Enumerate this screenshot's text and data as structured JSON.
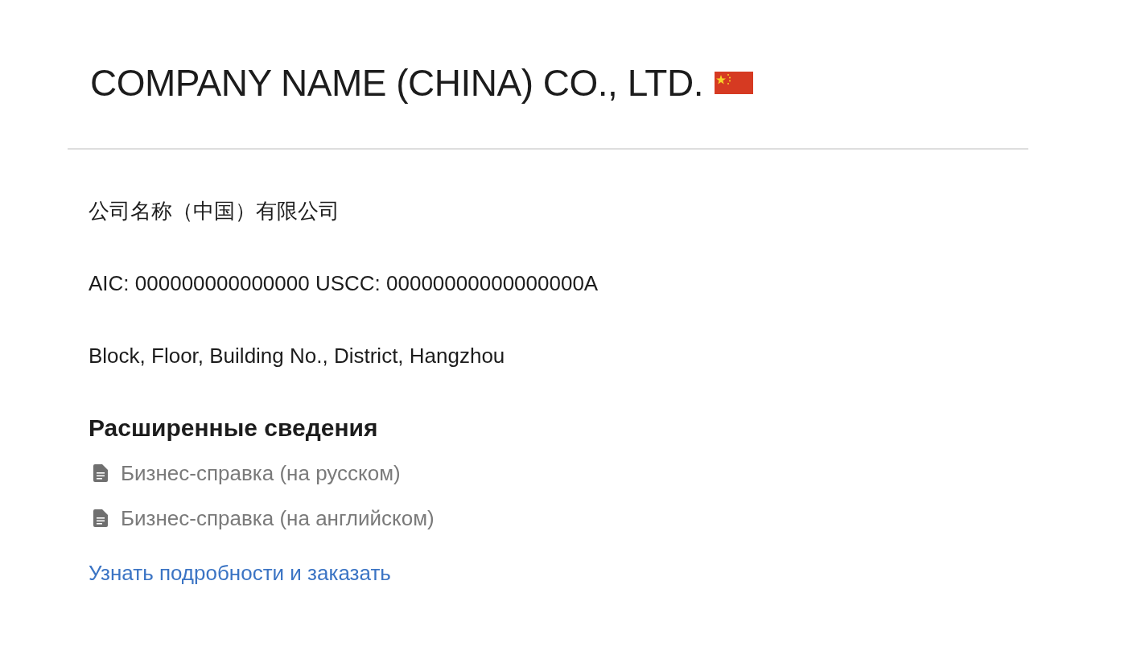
{
  "title": "COMPANY NAME (CHINA) CO., LTD.",
  "local_name": "公司名称（中国）有限公司",
  "registration": "AIC: 000000000000000 USCC: 00000000000000000A",
  "address": "Block, Floor, Building No., District, Hangzhou",
  "section": {
    "heading": "Расширенные сведения",
    "documents": [
      {
        "label": "Бизнес-справка (на русском)"
      },
      {
        "label": "Бизнес-справка (на английском)"
      }
    ],
    "link": "Узнать подробности и заказать"
  }
}
